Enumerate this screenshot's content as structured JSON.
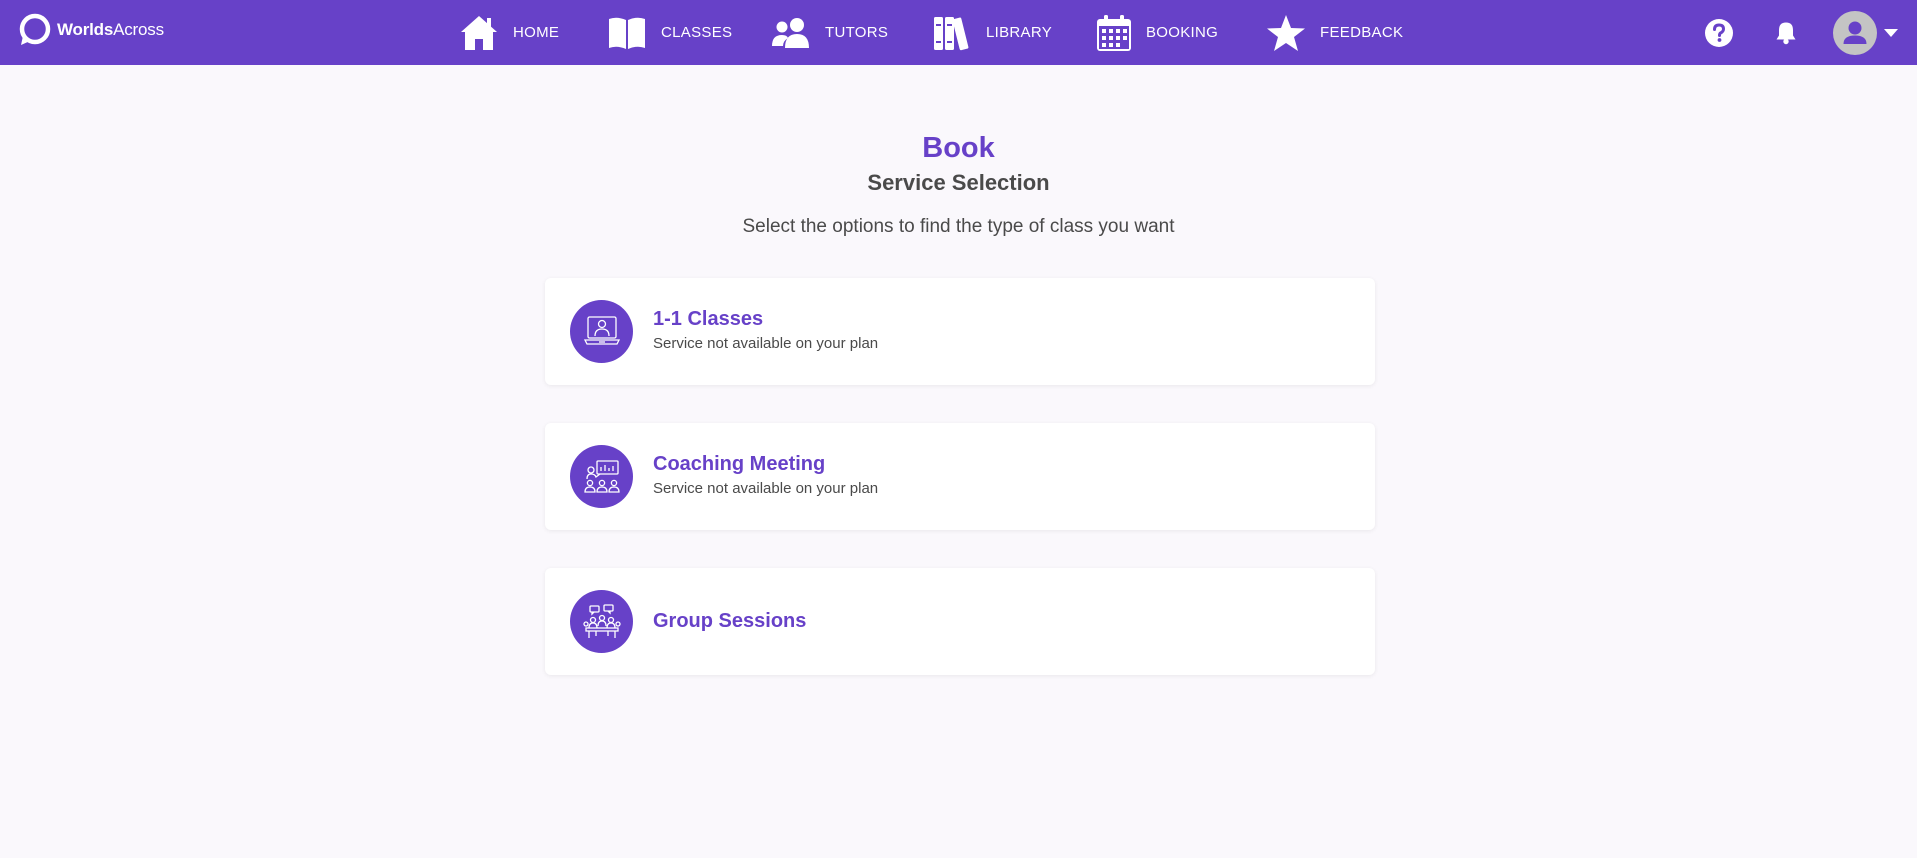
{
  "brand": {
    "name_bold": "Worlds",
    "name_regular": "Across",
    "icon": "speech-bubble-logo-icon"
  },
  "nav": {
    "items": [
      {
        "label": "HOME",
        "icon": "home-icon"
      },
      {
        "label": "CLASSES",
        "icon": "book-icon"
      },
      {
        "label": "TUTORS",
        "icon": "users-icon"
      },
      {
        "label": "LIBRARY",
        "icon": "library-icon"
      },
      {
        "label": "BOOKING",
        "icon": "calendar-icon"
      },
      {
        "label": "FEEDBACK",
        "icon": "star-icon"
      }
    ],
    "right_icons": [
      "help-icon",
      "bell-icon",
      "avatar",
      "caret-down-icon"
    ]
  },
  "page": {
    "title": "Book",
    "subtitle": "Service Selection",
    "description": "Select the options to find the type of class you want"
  },
  "services": [
    {
      "title": "1-1 Classes",
      "status": "Service not available on your plan",
      "icon": "online-tutor-icon"
    },
    {
      "title": "Coaching Meeting",
      "status": "Service not available on your plan",
      "icon": "coaching-meeting-icon"
    },
    {
      "title": "Group Sessions",
      "status": "",
      "icon": "group-session-icon"
    }
  ],
  "colors": {
    "brand_purple": "#6741c8",
    "background": "#faf8fc",
    "card": "#ffffff",
    "text_dark": "#4a4a4a",
    "avatar_grey": "#c4c4c4"
  }
}
